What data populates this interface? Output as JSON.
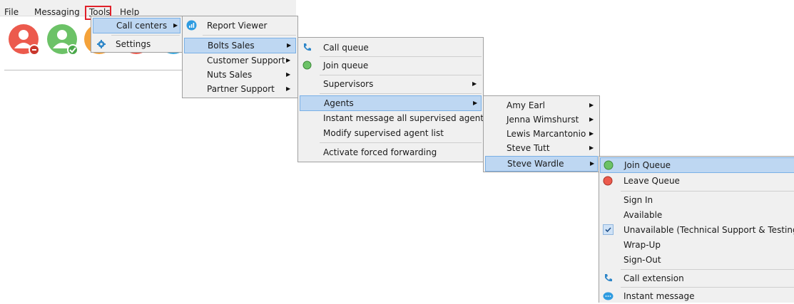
{
  "menubar": {
    "items": [
      "File",
      "Messaging",
      "Tools",
      "Help"
    ]
  },
  "tools_menu": {
    "items": [
      {
        "label": "Call centers",
        "icon": "none",
        "submenu": true
      },
      {
        "label": "Settings",
        "icon": "gear-icon",
        "submenu": false
      }
    ]
  },
  "call_centers_menu": {
    "header": {
      "label": "Report Viewer",
      "icon": "report-viewer-icon"
    },
    "items": [
      "Bolts Sales",
      "Customer Support",
      "Nuts Sales",
      "Partner Support"
    ]
  },
  "bolts_sales_menu": {
    "items": [
      {
        "label": "Call queue",
        "icon": "phone-icon"
      },
      {
        "label": "Join queue",
        "icon": "green-circle-icon"
      },
      {
        "label": "Supervisors",
        "icon": "none"
      },
      {
        "label": "Agents",
        "icon": "none"
      },
      {
        "label": "Instant message all supervised agents",
        "icon": "none"
      },
      {
        "label": "Modify supervised agent list",
        "icon": "none"
      },
      {
        "label": "Activate forced forwarding",
        "icon": "none"
      }
    ]
  },
  "agents_menu": {
    "items": [
      "Amy Earl",
      "Jenna Wimshurst",
      "Lewis Marcantonio",
      "Steve Tutt",
      "Steve Wardle"
    ]
  },
  "agent_actions_menu": {
    "items": [
      {
        "label": "Join Queue",
        "icon": "green-circle-icon"
      },
      {
        "label": "Leave Queue",
        "icon": "red-circle-icon"
      },
      {
        "label": "Sign In",
        "icon": "none"
      },
      {
        "label": "Available",
        "icon": "none"
      },
      {
        "label": "Unavailable (Technical Support & Testing)",
        "icon": "checkmark-icon"
      },
      {
        "label": "Wrap-Up",
        "icon": "none"
      },
      {
        "label": "Sign-Out",
        "icon": "none"
      },
      {
        "label": "Call extension",
        "icon": "phone-icon"
      },
      {
        "label": "Instant message",
        "icon": "chat-icon"
      }
    ]
  },
  "colors": {
    "highlight": "#bed7f2",
    "highlight_border": "#7ab0e6",
    "menu_bg": "#f0f0f0",
    "tools_outline": "#e0202a",
    "avatar_red": "#ec5a4d",
    "avatar_green": "#6cc267",
    "avatar_orange": "#f4a23a",
    "avatar_blue": "#3aa8de"
  }
}
